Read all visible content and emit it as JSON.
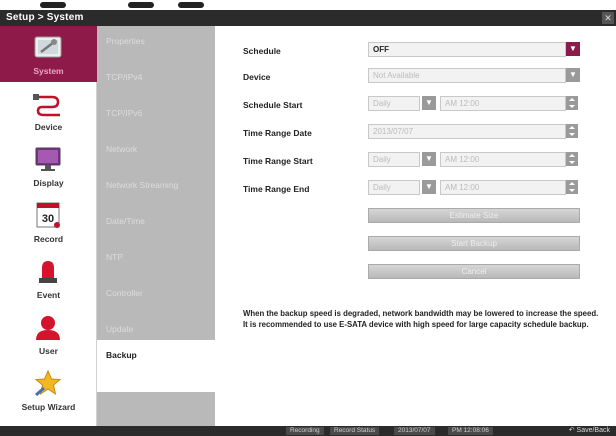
{
  "window": {
    "title": "Setup > System"
  },
  "sidebar": {
    "items": [
      {
        "label": "System",
        "icon": "system-tools-icon",
        "active": true
      },
      {
        "label": "Device",
        "icon": "cable-icon"
      },
      {
        "label": "Display",
        "icon": "monitor-icon"
      },
      {
        "label": "Record",
        "icon": "record-3d-icon"
      },
      {
        "label": "Event",
        "icon": "siren-icon"
      },
      {
        "label": "User",
        "icon": "user-icon"
      },
      {
        "label": "Setup Wizard",
        "icon": "wizard-star-icon"
      }
    ]
  },
  "submenu": {
    "items": [
      {
        "label": "Properties"
      },
      {
        "label": "TCP/IPv4"
      },
      {
        "label": "TCP/IPv6"
      },
      {
        "label": "Network"
      },
      {
        "label": "Network Streaming"
      },
      {
        "label": "Date/Time"
      },
      {
        "label": "NTP"
      },
      {
        "label": "Controller"
      },
      {
        "label": "Update"
      },
      {
        "label": "Backup",
        "active": true
      }
    ]
  },
  "form": {
    "schedule_label": "Schedule",
    "schedule_value": "OFF",
    "device_label": "Device",
    "device_value": "Not Available",
    "schedule_start_label": "Schedule Start",
    "schedule_start_day": "Daily",
    "schedule_start_time": "AM 12:00",
    "time_range_date_label": "Time Range Date",
    "time_range_date_value": "2013/07/07",
    "time_range_start_label": "Time Range Start",
    "time_range_start_day": "Daily",
    "time_range_start_time": "AM 12:00",
    "time_range_end_label": "Time Range End",
    "time_range_end_day": "Daily",
    "time_range_end_time": "AM 12:00",
    "estimate_size_label": "Estimate Size",
    "start_backup_label": "Start Backup",
    "cancel_label": "Cancel"
  },
  "note": "When the backup speed is degraded, network bandwidth may be lowered to increase the speed. It is recommended to use E-SATA device with high speed for large capacity schedule backup.",
  "statusbar": {
    "recording": "Recording",
    "status": "Record Status",
    "date": "2013/07/07",
    "time": "PM 12:08:06",
    "save_back": "Save/Back"
  },
  "colors": {
    "accent": "#8e1a4a",
    "submenu_bg": "#b9b9b9",
    "titlebar": "#2b2b2b"
  }
}
